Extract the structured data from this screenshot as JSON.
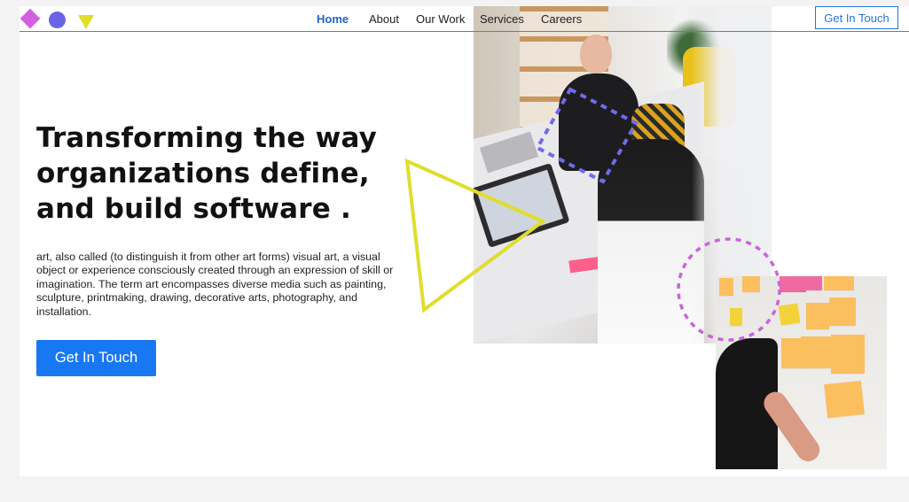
{
  "nav": {
    "links": [
      {
        "label": "Home",
        "active": true
      },
      {
        "label": "About",
        "active": false
      },
      {
        "label": "Our Work",
        "active": false
      },
      {
        "label": "Services",
        "active": false
      },
      {
        "label": "Careers",
        "active": false
      }
    ],
    "cta_label": "Get In Touch"
  },
  "hero": {
    "title": "Transforming  the way organizations define, and build software .",
    "description": "art, also called (to distinguish it from other art forms) visual art, a visual object or experience consciously created through an expression of skill or imagination. The term art encompasses diverse media such as painting, sculpture, printmaking, drawing, decorative arts, photography, and installation.",
    "cta_label": "Get In Touch"
  },
  "icons": {
    "logo": [
      "diamond-shape",
      "circle-shape",
      "triangle-shape"
    ]
  },
  "colors": {
    "accent_blue": "#1877f2",
    "nav_active": "#1e64c8",
    "logo_diamond": "#d35ee0",
    "logo_circle": "#6b63e6",
    "logo_triangle": "#e2dd2a",
    "deco_triangle": "#e0dd2e",
    "deco_dashed_square": "#6f6bea",
    "deco_dashed_circle": "#c865d9"
  }
}
